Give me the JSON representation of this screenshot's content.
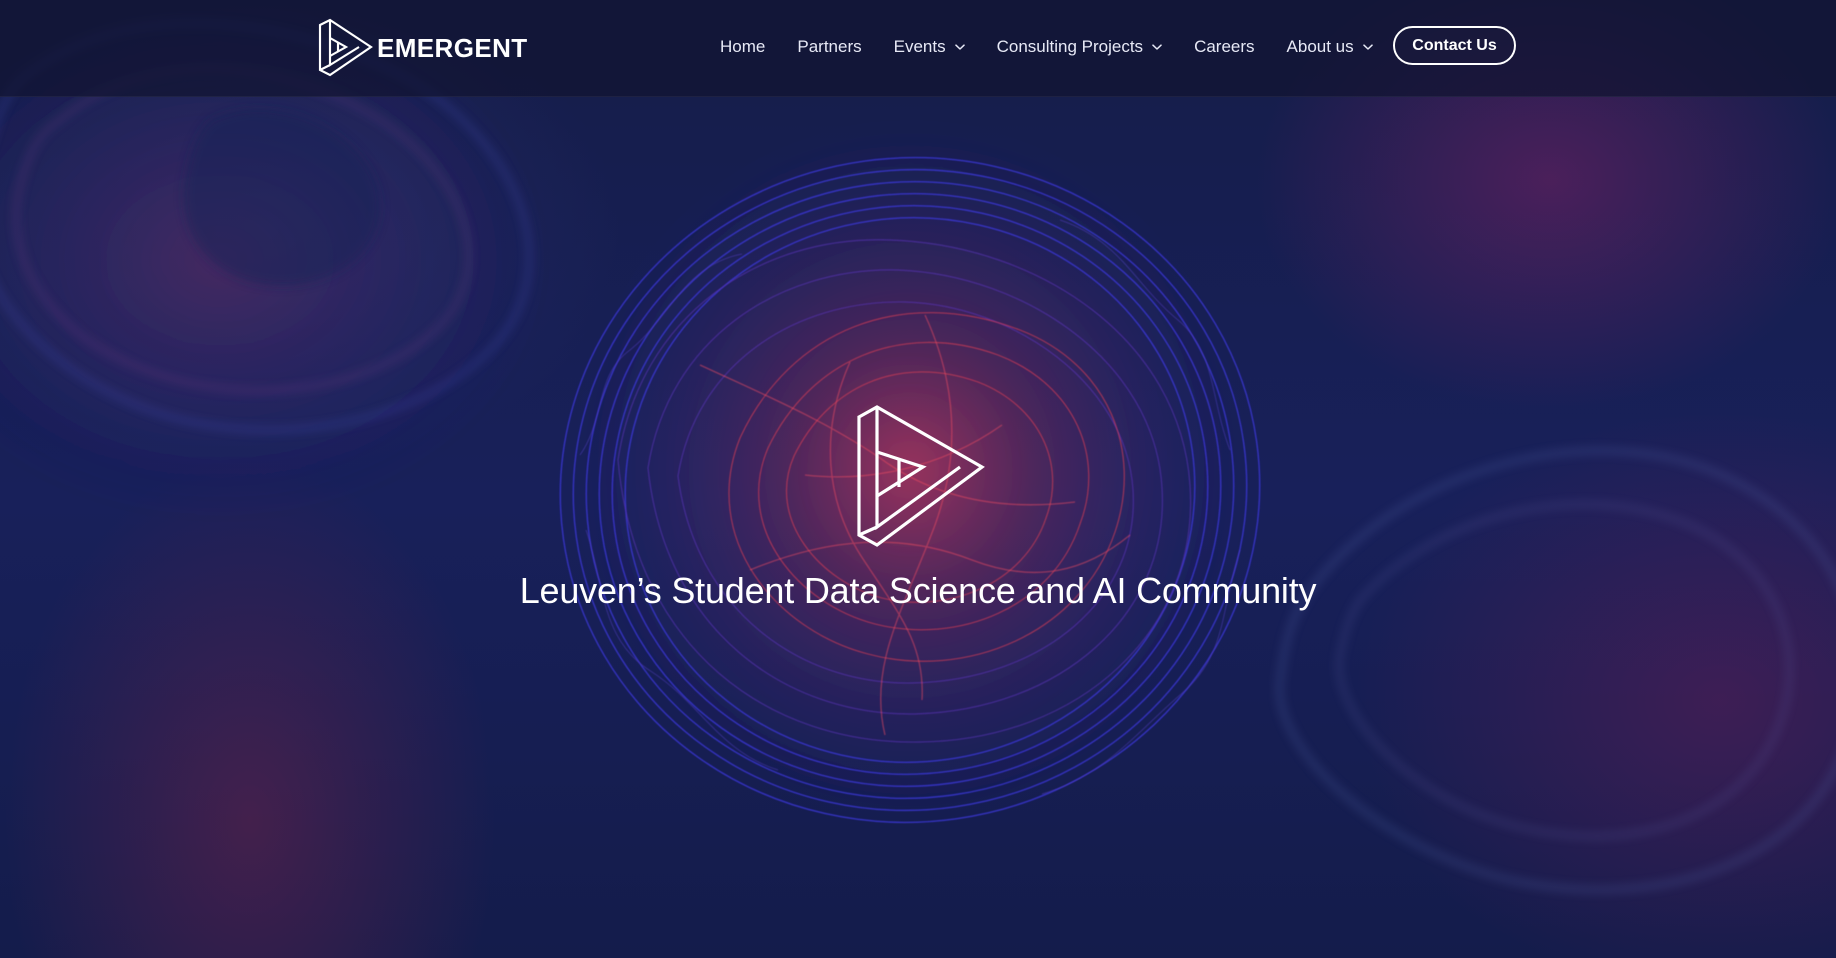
{
  "header": {
    "brand": "EMERGENT",
    "nav_links": [
      {
        "label": "Home"
      },
      {
        "label": "Partners"
      },
      {
        "label": "Events"
      },
      {
        "label": "Consulting Projects"
      },
      {
        "label": "Careers"
      },
      {
        "label": "About us"
      }
    ],
    "contact_button": "Contact Us"
  },
  "hero": {
    "tagline": "Leuven’s Student Data Science and AI Community"
  },
  "colors": {
    "background": "#151d49",
    "accent_blue": "#4b3ff0",
    "accent_red": "#e53d52",
    "text": "#ffffff"
  },
  "icons": {
    "brand": "emergent-logo-icon",
    "dropdown": "chevron-down-icon"
  }
}
